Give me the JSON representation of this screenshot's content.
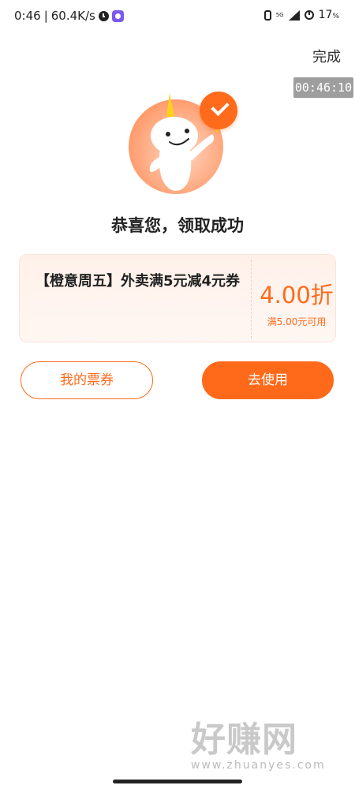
{
  "status_bar": {
    "time": "0:46",
    "separator": "|",
    "net_speed": "60.4K/s",
    "network": "5G",
    "battery": "17",
    "battery_unit": "%"
  },
  "header": {
    "done_label": "完成",
    "timer": "00:46:10"
  },
  "result": {
    "title": "恭喜您，领取成功"
  },
  "coupon": {
    "name": "【橙意周五】外卖满5元减4元券",
    "discount": "4.00折",
    "condition": "满5.00元可用"
  },
  "actions": {
    "my_coupons": "我的票券",
    "use": "去使用"
  },
  "watermark": {
    "logo": "好赚网",
    "url": "www.zhuanyes.com"
  },
  "colors": {
    "accent": "#ff6a1a",
    "timer_bg": "#9e9e9e"
  }
}
